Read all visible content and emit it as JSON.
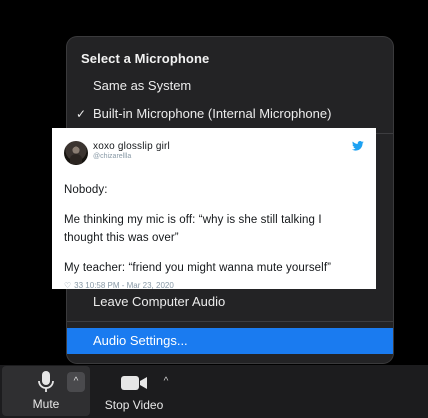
{
  "menu": {
    "heading": "Select a Microphone",
    "items": {
      "same_as_system": "Same as System",
      "builtin": "Built-in Microphone (Internal Microphone)",
      "leave_audio": "Leave Computer Audio",
      "audio_settings": "Audio Settings..."
    },
    "check_glyph": "✓",
    "highlight_color": "#1a7bf0"
  },
  "tweet": {
    "display_name": "xoxo glosslip girl",
    "handle": "@chizarellla",
    "lines": [
      "Nobody:",
      "Me thinking my mic is off: “why is she still talking I",
      "thought this was over”",
      "My teacher: “friend you might wanna mute yourself”"
    ],
    "meta": "33  10:58 PM - Mar 23, 2020",
    "bird_color": "#1da1f2"
  },
  "toolbar": {
    "mute_label": "Mute",
    "mute_caret": "^",
    "video_label": "Stop Video",
    "video_caret": "^"
  }
}
